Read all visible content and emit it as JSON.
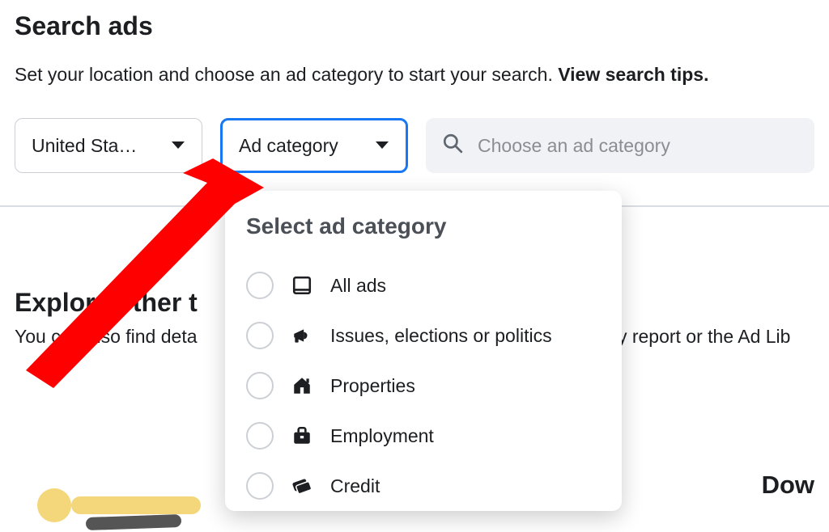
{
  "header": {
    "title": "Search ads",
    "subtitle_prefix": "Set your location and choose an ad category to start your search. ",
    "subtitle_link": "View search tips."
  },
  "filters": {
    "location_label": "United Sta…",
    "category_label": "Ad category",
    "search_placeholder": "Choose an ad category"
  },
  "popover": {
    "title": "Select ad category",
    "options": [
      {
        "icon": "tablet-icon",
        "label": "All ads"
      },
      {
        "icon": "megaphone-icon",
        "label": "Issues, elections or politics"
      },
      {
        "icon": "house-icon",
        "label": "Properties"
      },
      {
        "icon": "briefcase-icon",
        "label": "Employment"
      },
      {
        "icon": "credit-icon",
        "label": "Credit"
      }
    ]
  },
  "section2": {
    "title_visible": "Explore other t",
    "desc_visible_left": "You can also find deta",
    "desc_visible_right": "ry report or the Ad Lib",
    "bottom_right": "Dow"
  },
  "colors": {
    "focus_border": "#1877f2",
    "annotation": "#ff0000"
  }
}
